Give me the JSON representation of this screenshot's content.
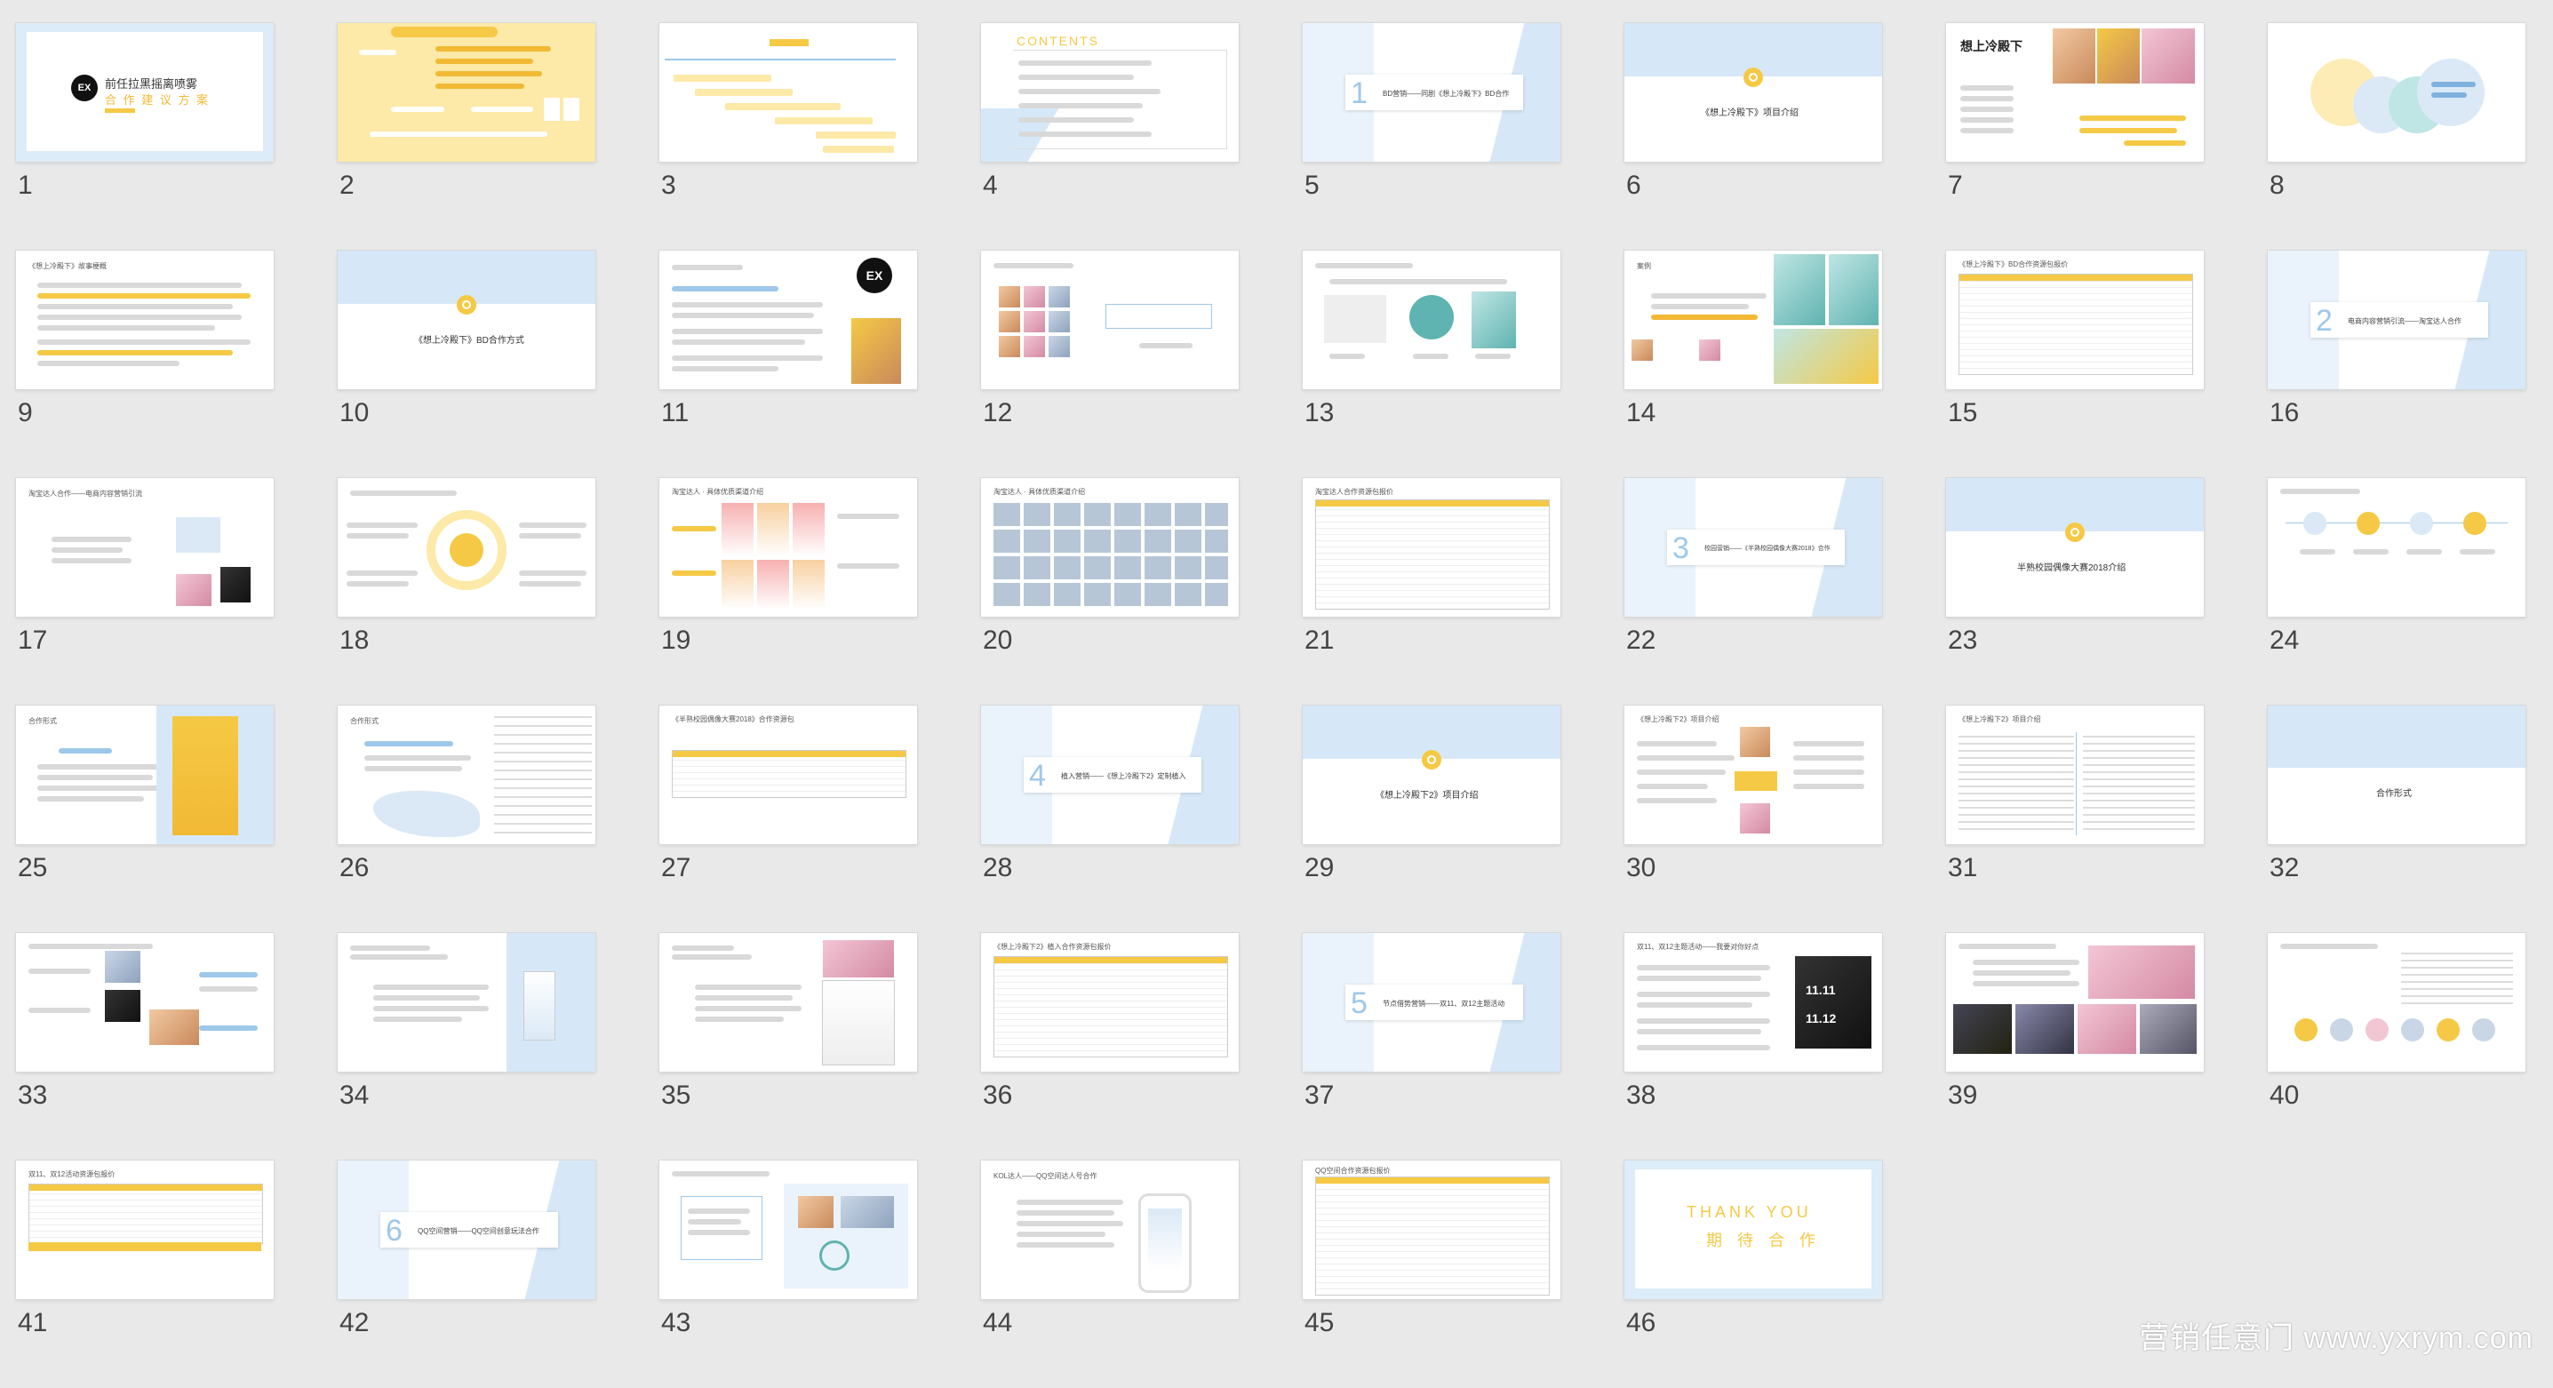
{
  "slides": [
    {
      "n": "1",
      "lines": [
        "前任拉黑摇离喷雾",
        "合 作 建 议 方 案"
      ],
      "logo": "EX"
    },
    {
      "n": "2",
      "lines": []
    },
    {
      "n": "3",
      "lines": []
    },
    {
      "n": "4",
      "lines": [
        "CONTENTS"
      ]
    },
    {
      "n": "5",
      "lines": [
        "1",
        "BD营销——同剧《想上冷殿下》BD合作"
      ]
    },
    {
      "n": "6",
      "lines": [
        "《想上冷殿下》项目介绍"
      ]
    },
    {
      "n": "7",
      "lines": []
    },
    {
      "n": "8",
      "lines": []
    },
    {
      "n": "9",
      "lines": [
        "《想上冷殿下》故事梗概"
      ]
    },
    {
      "n": "10",
      "lines": [
        "《想上冷殿下》BD合作方式"
      ]
    },
    {
      "n": "11",
      "lines": [
        "EX"
      ]
    },
    {
      "n": "12",
      "lines": []
    },
    {
      "n": "13",
      "lines": []
    },
    {
      "n": "14",
      "lines": [
        "案例"
      ]
    },
    {
      "n": "15",
      "lines": [
        "《想上冷殿下》BD合作资源包报价"
      ]
    },
    {
      "n": "16",
      "lines": [
        "2",
        "电商内容营销引流——淘宝达人合作"
      ]
    },
    {
      "n": "17",
      "lines": [
        "淘宝达人合作——电商内容营销引流"
      ]
    },
    {
      "n": "18",
      "lines": []
    },
    {
      "n": "19",
      "lines": [
        "淘宝达人 · 具体优质渠道介绍"
      ]
    },
    {
      "n": "20",
      "lines": [
        "淘宝达人 · 具体优质渠道介绍"
      ]
    },
    {
      "n": "21",
      "lines": [
        "淘宝达人合作资源包报价"
      ]
    },
    {
      "n": "22",
      "lines": [
        "3",
        "校园营销——《半熟校园偶像大赛2018》合作"
      ]
    },
    {
      "n": "23",
      "lines": [
        "半熟校园偶像大赛2018介绍"
      ]
    },
    {
      "n": "24",
      "lines": []
    },
    {
      "n": "25",
      "lines": [
        "合作形式"
      ]
    },
    {
      "n": "26",
      "lines": [
        "合作形式"
      ]
    },
    {
      "n": "27",
      "lines": [
        "《半熟校园偶像大赛2018》合作资源包"
      ]
    },
    {
      "n": "28",
      "lines": [
        "4",
        "植入营销——《想上冷殿下2》定制植入"
      ]
    },
    {
      "n": "29",
      "lines": [
        "《想上冷殿下2》项目介绍"
      ]
    },
    {
      "n": "30",
      "lines": [
        "《想上冷殿下2》项目介绍"
      ]
    },
    {
      "n": "31",
      "lines": [
        "《想上冷殿下2》项目介绍"
      ]
    },
    {
      "n": "32",
      "lines": [
        "合作形式"
      ]
    },
    {
      "n": "33",
      "lines": []
    },
    {
      "n": "34",
      "lines": []
    },
    {
      "n": "35",
      "lines": []
    },
    {
      "n": "36",
      "lines": [
        "《想上冷殿下2》植入合作资源包报价"
      ]
    },
    {
      "n": "37",
      "lines": [
        "5",
        "节点借势营销——双11、双12主题活动"
      ]
    },
    {
      "n": "38",
      "lines": [
        "双11、双12主题活动——我要对你好点"
      ]
    },
    {
      "n": "39",
      "lines": []
    },
    {
      "n": "40",
      "lines": []
    },
    {
      "n": "41",
      "lines": [
        "双11、双12活动资源包报价"
      ]
    },
    {
      "n": "42",
      "lines": [
        "6",
        "QQ空间营销——QQ空间创意玩法合作"
      ]
    },
    {
      "n": "43",
      "lines": []
    },
    {
      "n": "44",
      "lines": [
        "KOL达人——QQ空间达人号合作"
      ]
    },
    {
      "n": "45",
      "lines": [
        "QQ空间合作资源包报价"
      ]
    },
    {
      "n": "46",
      "lines": [
        "THANK YOU",
        "期 待 合 作"
      ]
    }
  ],
  "watermark": "营销任意门 www.yxrym.com"
}
